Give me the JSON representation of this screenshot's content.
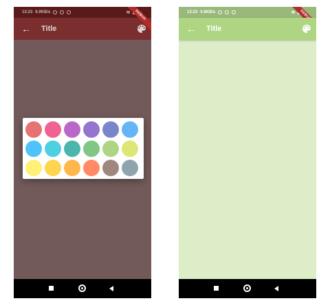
{
  "left_screen": {
    "status": {
      "time": "13:23",
      "speed": "6.9KB/s"
    },
    "appbar": {
      "title": "Title"
    },
    "debug_label": "DEBUG",
    "palette_dialog": {
      "colors": [
        "#e57373",
        "#f06292",
        "#ba68c8",
        "#9575cd",
        "#7986cb",
        "#64b5f6",
        "#4fc3f7",
        "#4dd0e1",
        "#4db6ac",
        "#81c784",
        "#aed581",
        "#dce775",
        "#fff176",
        "#ffd54f",
        "#ffb74d",
        "#ff8a65",
        "#a1887f",
        "#90a4ae"
      ]
    }
  },
  "right_screen": {
    "status": {
      "time": "13:23",
      "speed": "0.8KB/s"
    },
    "appbar": {
      "title": "Title"
    },
    "debug_label": "DEBUG"
  },
  "icons": {
    "back": "arrow-back-icon",
    "palette": "palette-icon",
    "nav_recents": "recents-square-icon",
    "nav_home": "home-circle-icon",
    "nav_back": "back-triangle-icon"
  },
  "theme": {
    "primary": "#aed581",
    "background": "#dcedc8"
  }
}
